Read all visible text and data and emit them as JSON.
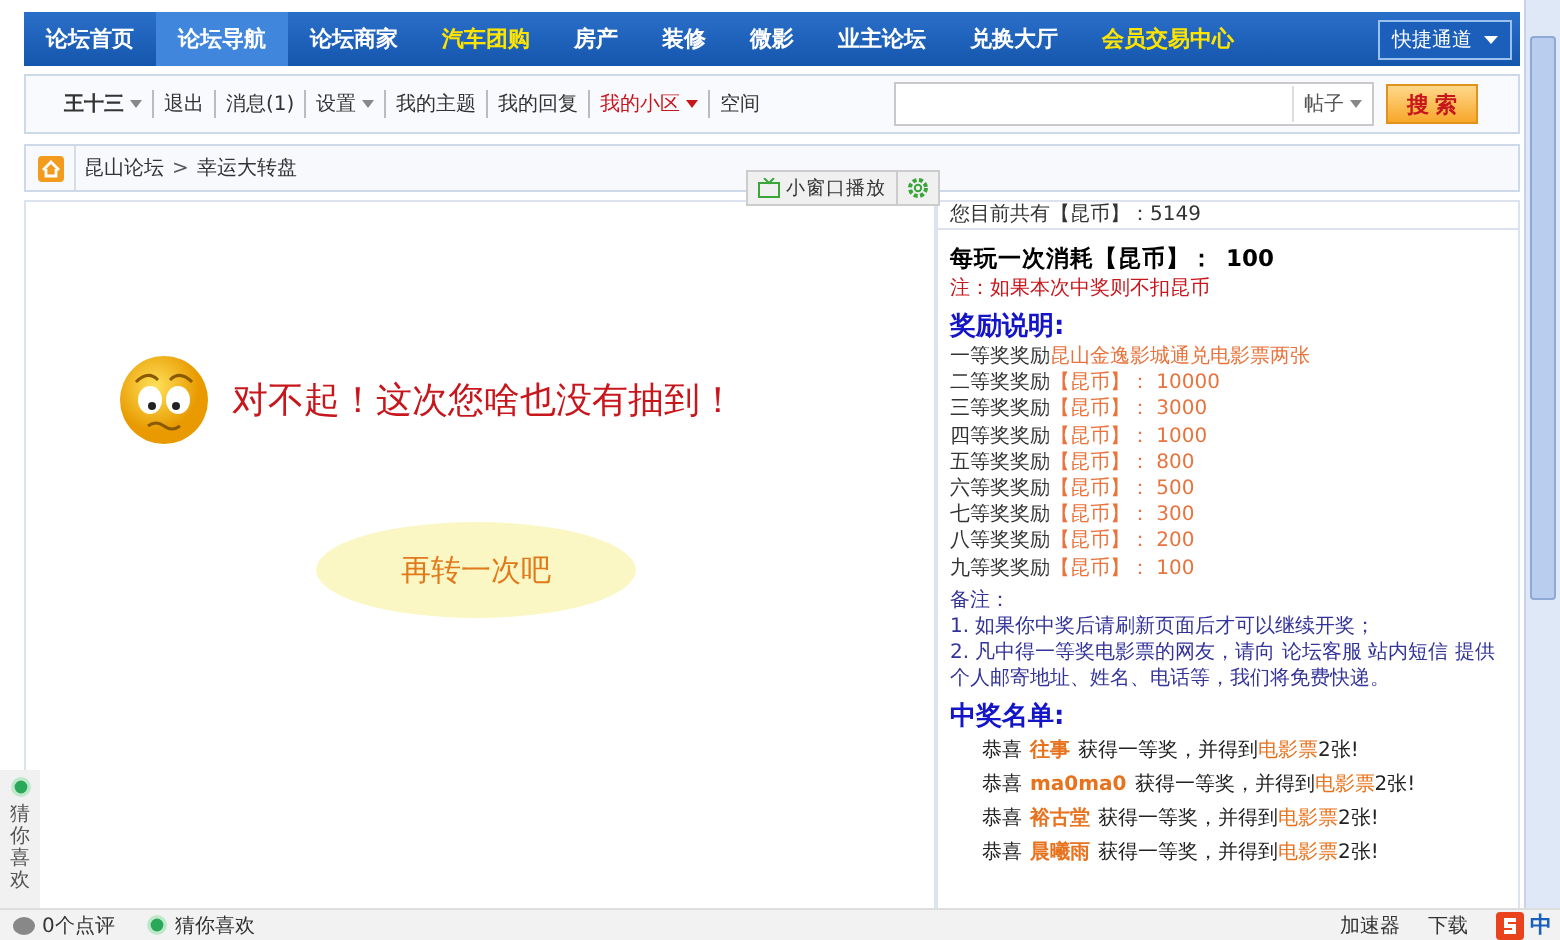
{
  "nav": {
    "items": [
      {
        "label": "论坛首页",
        "selected": false,
        "kind": "normal"
      },
      {
        "label": "论坛导航",
        "selected": true,
        "kind": "normal"
      },
      {
        "label": "论坛商家",
        "selected": false,
        "kind": "normal"
      },
      {
        "label": "汽车团购",
        "selected": false,
        "kind": "promo"
      },
      {
        "label": "房产",
        "selected": false,
        "kind": "normal"
      },
      {
        "label": "装修",
        "selected": false,
        "kind": "normal"
      },
      {
        "label": "微影",
        "selected": false,
        "kind": "normal"
      },
      {
        "label": "业主论坛",
        "selected": false,
        "kind": "normal"
      },
      {
        "label": "兑换大厅",
        "selected": false,
        "kind": "normal"
      },
      {
        "label": "会员交易中心",
        "selected": false,
        "kind": "promo"
      }
    ],
    "quick_menu": "快捷通道"
  },
  "user_bar": {
    "items": [
      {
        "label": "王十三",
        "kind": "user",
        "has_menu": true
      },
      {
        "label": "退出",
        "kind": "link",
        "has_menu": false
      },
      {
        "label": "消息(1)",
        "kind": "link",
        "has_menu": false
      },
      {
        "label": "设置",
        "kind": "link",
        "has_menu": true
      },
      {
        "label": "我的主题",
        "kind": "link",
        "has_menu": false
      },
      {
        "label": "我的回复",
        "kind": "link",
        "has_menu": false
      },
      {
        "label": "我的小区",
        "kind": "highlight",
        "has_menu": true
      },
      {
        "label": "空间",
        "kind": "link",
        "has_menu": false
      }
    ],
    "search": {
      "scope": "帖子",
      "button": "搜 索"
    }
  },
  "breadcrumb": {
    "items": [
      "昆山论坛",
      "幸运大转盘"
    ],
    "separator": ">"
  },
  "player_tab": "小窗口播放",
  "result": {
    "message": "对不起！这次您啥也没有抽到！",
    "retry_button": "再转一次吧"
  },
  "info": {
    "balance": "您目前共有【昆币】：5149",
    "cost_label": "每玩一次消耗【昆币】：",
    "cost_value": "100",
    "note": "注：如果本次中奖则不扣昆币",
    "prizes_title": "奖励说明:",
    "prizes": [
      {
        "rank": "一等奖奖励",
        "reward": "昆山金逸影城通兑电影票两张"
      },
      {
        "rank": "二等奖奖励",
        "reward": "【昆币】： 10000"
      },
      {
        "rank": "三等奖奖励",
        "reward": "【昆币】： 3000"
      },
      {
        "rank": "四等奖奖励",
        "reward": "【昆币】： 1000"
      },
      {
        "rank": "五等奖奖励",
        "reward": "【昆币】： 800"
      },
      {
        "rank": "六等奖奖励",
        "reward": "【昆币】： 500"
      },
      {
        "rank": "七等奖奖励",
        "reward": "【昆币】： 300"
      },
      {
        "rank": "八等奖奖励",
        "reward": "【昆币】： 200"
      },
      {
        "rank": "九等奖奖励",
        "reward": "【昆币】： 100"
      }
    ],
    "remarks_title": "备注：",
    "remarks": [
      "1. 如果你中奖后请刷新页面后才可以继续开奖；",
      "2. 凡中得一等奖电影票的网友，请向 论坛客服 站内短信 提供个人邮寄地址、姓名、电话等，我们将免费快递。"
    ],
    "winners_title": "中奖名单:",
    "winners": [
      {
        "prefix": "恭喜",
        "name": "往事",
        "action": "获得一等奖，并得到",
        "prize": "电影票",
        "suffix": "2张!"
      },
      {
        "prefix": "恭喜",
        "name": "ma0ma0",
        "action": "获得一等奖，并得到",
        "prize": "电影票",
        "suffix": "2张!"
      },
      {
        "prefix": "恭喜",
        "name": "裕古堂",
        "action": "获得一等奖，并得到",
        "prize": "电影票",
        "suffix": "2张!"
      },
      {
        "prefix": "恭喜",
        "name": "晨曦雨",
        "action": "获得一等奖，并得到",
        "prize": "电影票",
        "suffix": "2张!"
      }
    ]
  },
  "side_widget": {
    "label": "猜你喜欢"
  },
  "status_bar": {
    "comments": "0个点评",
    "guess": "猜你喜欢",
    "tray": [
      "加速器",
      "下载"
    ],
    "ime": "中"
  }
}
